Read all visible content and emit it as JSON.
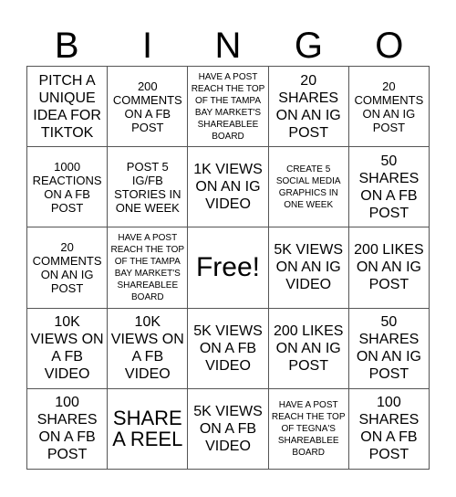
{
  "header": [
    "B",
    "I",
    "N",
    "G",
    "O"
  ],
  "cells": [
    {
      "text": "PITCH A UNIQUE IDEA FOR TIKTOK",
      "size": "l"
    },
    {
      "text": "200 COMMENTS ON A FB POST",
      "size": "m"
    },
    {
      "text": "HAVE A POST REACH THE TOP OF THE TAMPA BAY MARKET'S SHAREABLEE BOARD",
      "size": "s"
    },
    {
      "text": "20 SHARES ON AN IG POST",
      "size": "l"
    },
    {
      "text": "20 COMMENTS ON AN IG POST",
      "size": "m"
    },
    {
      "text": "1000 REACTIONS ON A FB POST",
      "size": "m"
    },
    {
      "text": "POST 5 IG/FB STORIES IN ONE WEEK",
      "size": "m"
    },
    {
      "text": "1K VIEWS ON AN IG VIDEO",
      "size": "l"
    },
    {
      "text": "CREATE 5 SOCIAL MEDIA GRAPHICS IN ONE WEEK",
      "size": "s"
    },
    {
      "text": "50 SHARES ON A FB POST",
      "size": "l"
    },
    {
      "text": "20 COMMENTS ON AN IG POST",
      "size": "m"
    },
    {
      "text": "HAVE A POST REACH THE TOP OF THE TAMPA BAY MARKET'S SHAREABLEE BOARD",
      "size": "s"
    },
    {
      "text": "Free!",
      "size": "free"
    },
    {
      "text": "5K VIEWS ON AN IG VIDEO",
      "size": "l"
    },
    {
      "text": "200 LIKES ON AN IG POST",
      "size": "l"
    },
    {
      "text": "10K VIEWS ON A FB VIDEO",
      "size": "l"
    },
    {
      "text": "10K VIEWS ON A FB VIDEO",
      "size": "l"
    },
    {
      "text": "5K VIEWS ON A FB VIDEO",
      "size": "l"
    },
    {
      "text": "200 LIKES ON AN IG POST",
      "size": "l"
    },
    {
      "text": "50 SHARES ON AN IG POST",
      "size": "l"
    },
    {
      "text": "100 SHARES ON A FB POST",
      "size": "l"
    },
    {
      "text": "SHARE A REEL",
      "size": "xl"
    },
    {
      "text": "5K VIEWS ON A FB VIDEO",
      "size": "l"
    },
    {
      "text": "HAVE A POST REACH THE TOP OF TEGNA'S SHAREABLEE BOARD",
      "size": "s"
    },
    {
      "text": "100 SHARES ON A FB POST",
      "size": "l"
    }
  ]
}
